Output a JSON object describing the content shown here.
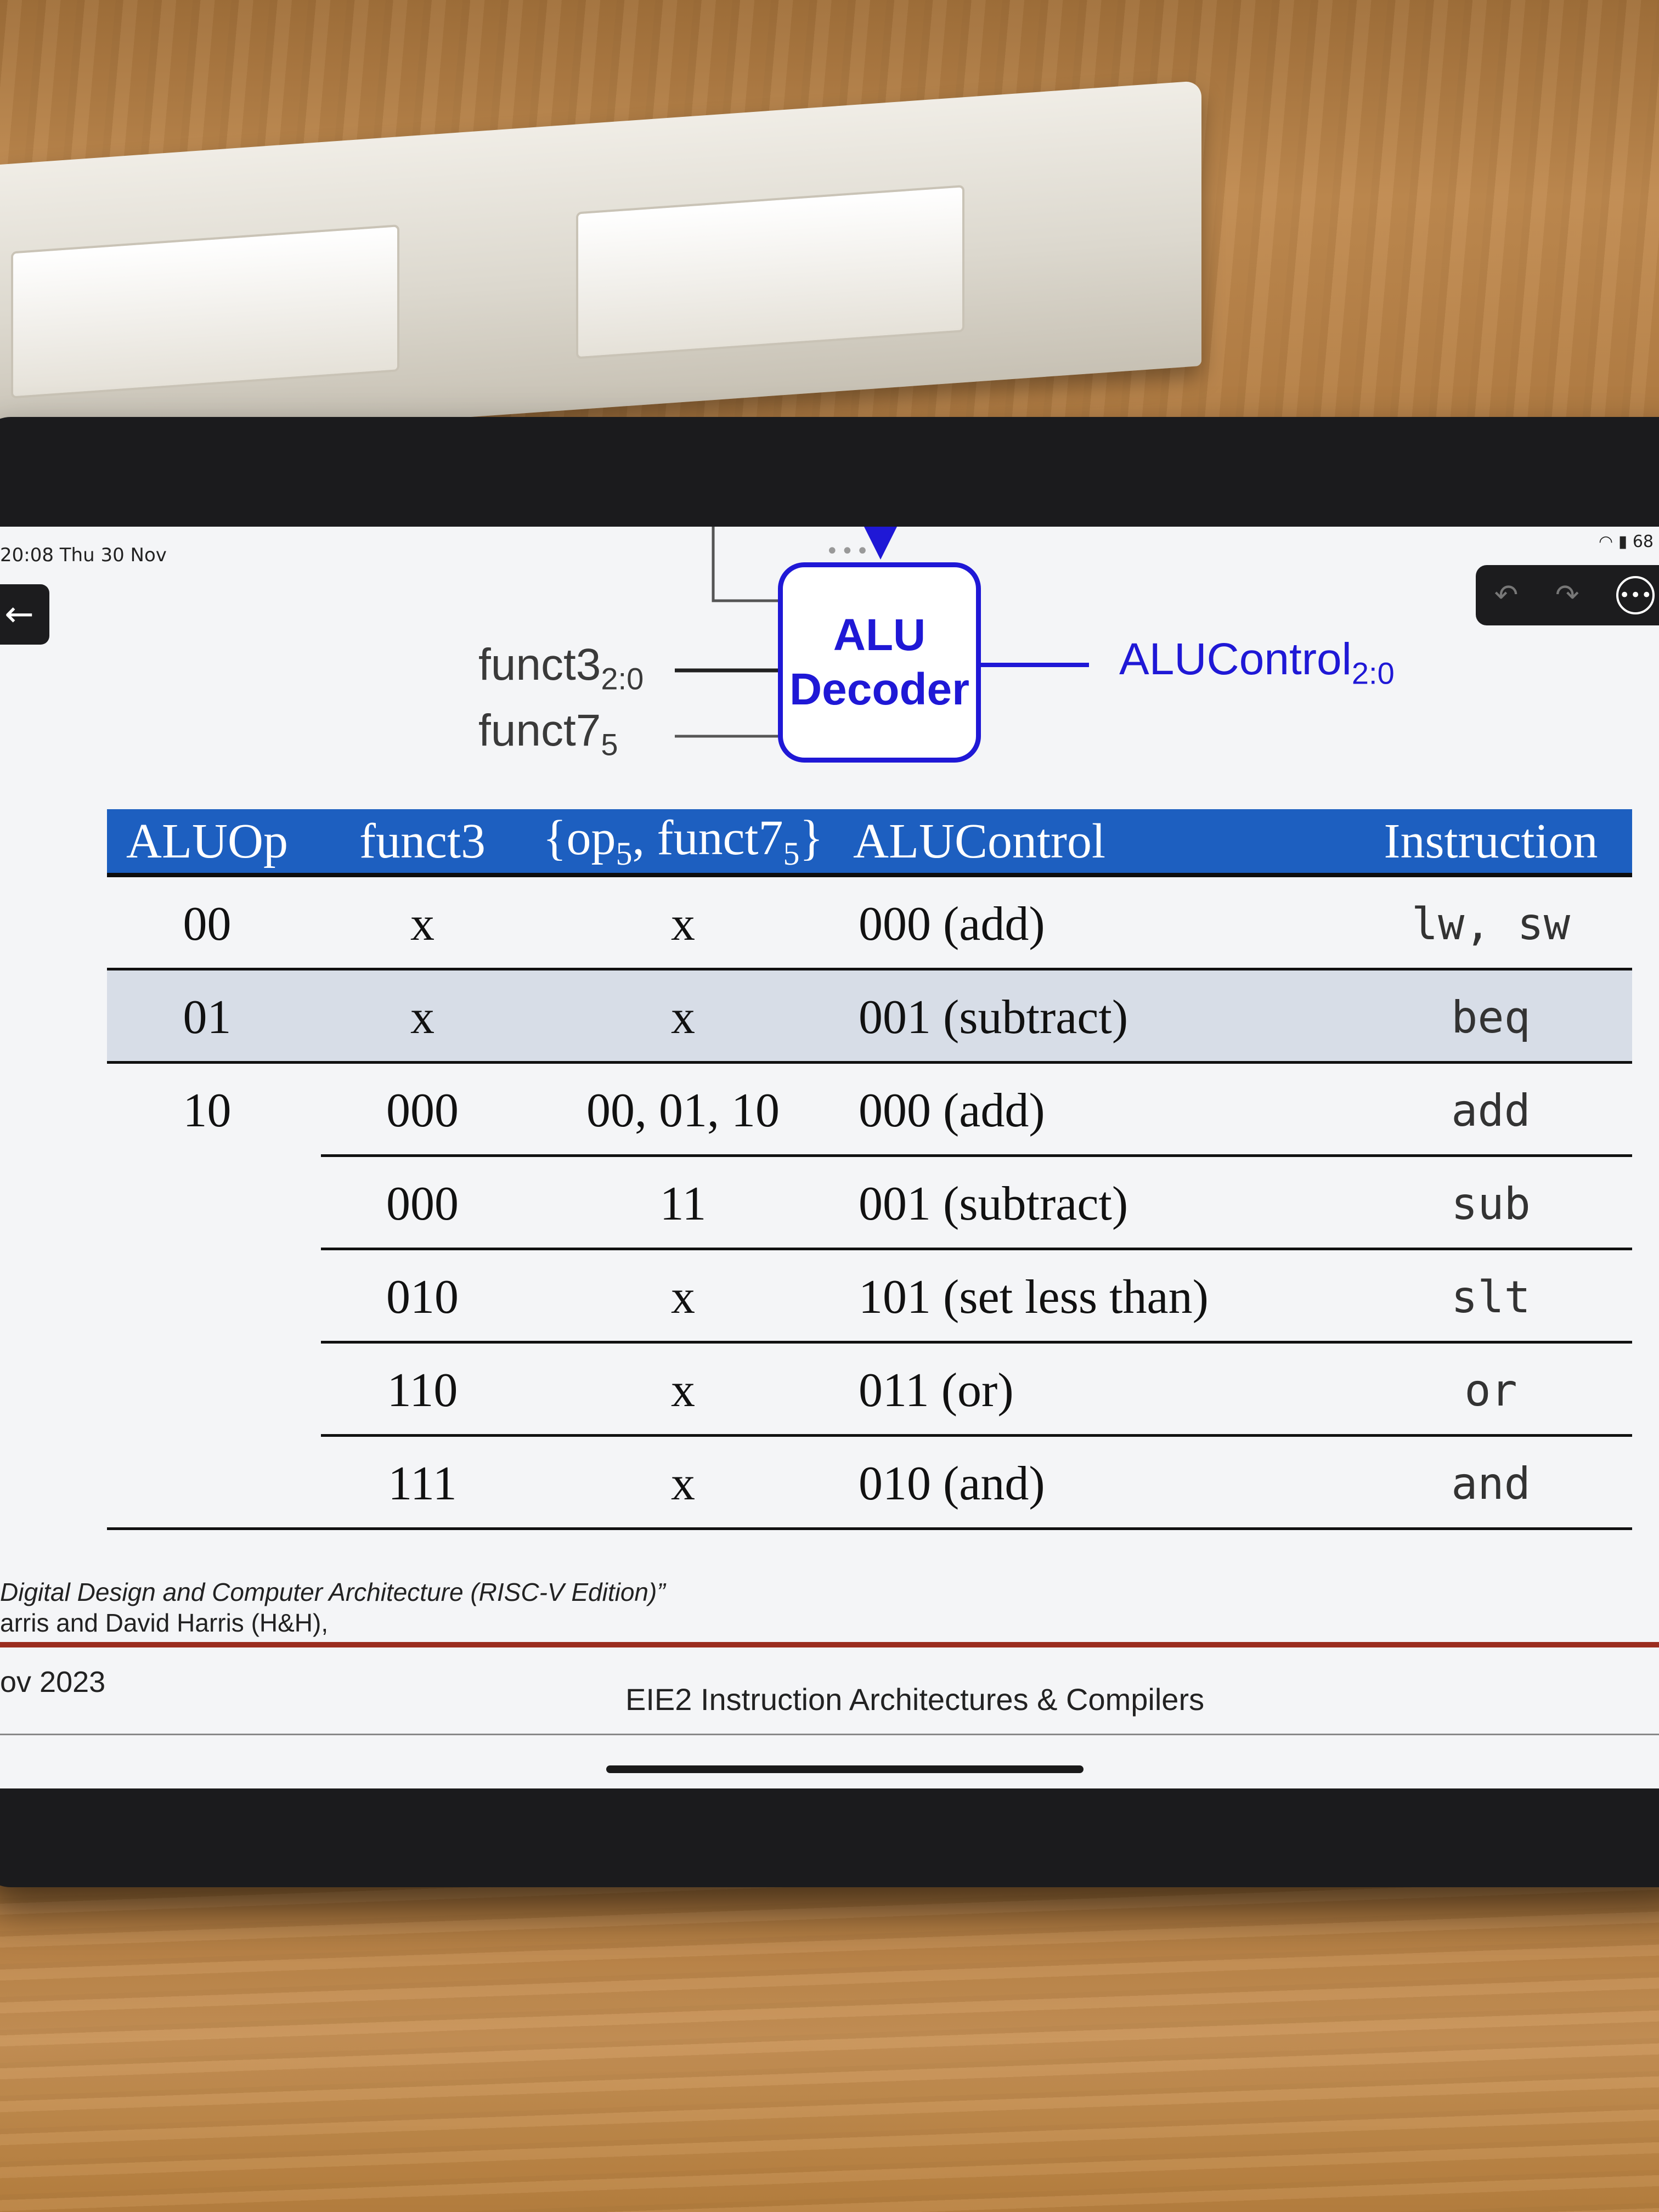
{
  "status": {
    "time_date": "20:08  Thu 30 Nov",
    "battery": "68"
  },
  "diagram": {
    "in1": "funct3",
    "in1_sub": "2:0",
    "in2": "funct7",
    "in2_sub": "5",
    "box_line1": "ALU",
    "box_line2": "Decoder",
    "out": "ALUControl",
    "out_sub": "2:0"
  },
  "table": {
    "headers": [
      "ALUOp",
      "funct3",
      "{op",
      "5",
      ", funct7",
      "5",
      "}",
      "ALUControl",
      "Instruction"
    ],
    "rows": [
      {
        "aluop": "00",
        "funct3": "x",
        "opf7": "x",
        "alucontrol": "000 (add)",
        "instr": "lw, sw"
      },
      {
        "aluop": "01",
        "funct3": "x",
        "opf7": "x",
        "alucontrol": "001 (subtract)",
        "instr": "beq"
      },
      {
        "aluop": "10",
        "funct3": "000",
        "opf7": "00, 01, 10",
        "alucontrol": "000 (add)",
        "instr": "add"
      },
      {
        "aluop": "",
        "funct3": "000",
        "opf7": "11",
        "alucontrol": "001 (subtract)",
        "instr": "sub"
      },
      {
        "aluop": "",
        "funct3": "010",
        "opf7": "x",
        "alucontrol": "101 (set less than)",
        "instr": "slt"
      },
      {
        "aluop": "",
        "funct3": "110",
        "opf7": "x",
        "alucontrol": "011 (or)",
        "instr": "or"
      },
      {
        "aluop": "",
        "funct3": "111",
        "opf7": "x",
        "alucontrol": "010 (and)",
        "instr": "and"
      }
    ]
  },
  "footer": {
    "cite1": "Digital Design and Computer Architecture (RISC-V Edition)”",
    "cite2": "arris and David Harris (H&H),",
    "date": "ov 2023",
    "course": "EIE2 Instruction Architectures & Compilers"
  },
  "colors": {
    "header_blue": "#1d5fc0",
    "decoder_blue": "#1f18d6",
    "shade_row": "#d7dde7",
    "footer_rule": "#9b2d1f"
  }
}
